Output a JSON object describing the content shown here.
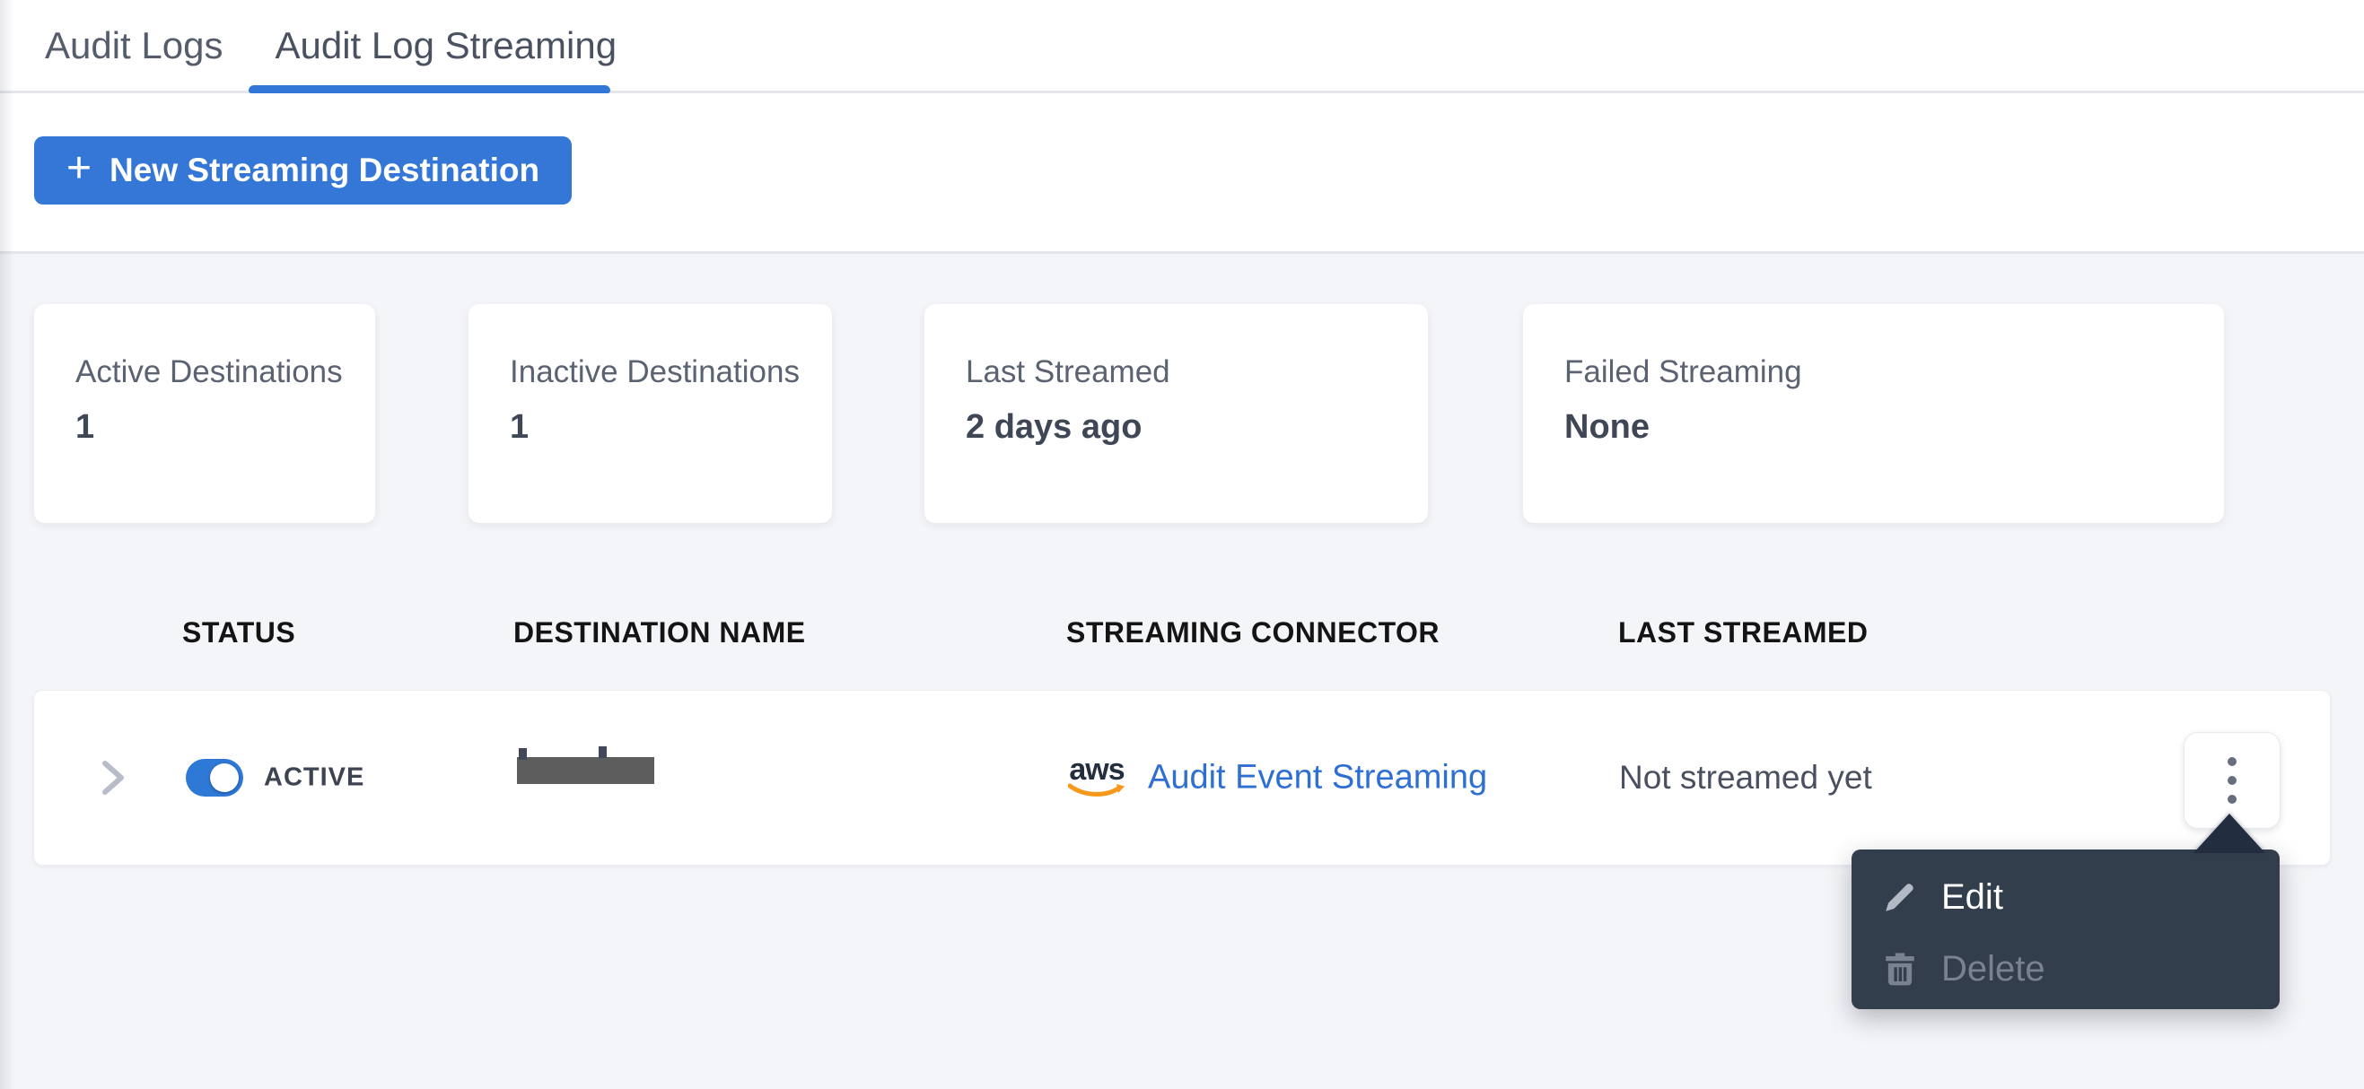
{
  "tabs": {
    "items": [
      {
        "label": "Audit Logs",
        "active": false
      },
      {
        "label": "Audit Log Streaming",
        "active": true
      }
    ]
  },
  "toolbar": {
    "plus_glyph": "+",
    "new_destination_label": "New Streaming Destination"
  },
  "stats": [
    {
      "label": "Active Destinations",
      "value": "1"
    },
    {
      "label": "Inactive Destinations",
      "value": "1"
    },
    {
      "label": "Last Streamed",
      "value": "2 days ago"
    },
    {
      "label": "Failed Streaming",
      "value": "None"
    }
  ],
  "table": {
    "headers": [
      "STATUS",
      "DESTINATION NAME",
      "STREAMING CONNECTOR",
      "LAST STREAMED"
    ],
    "row": {
      "status_label": "ACTIVE",
      "toggle_on": true,
      "destination_name_redacted": true,
      "connector_logo": "aws",
      "connector_label": "Audit Event Streaming",
      "last_streamed": "Not streamed yet"
    }
  },
  "menu": {
    "items": [
      {
        "label": "Edit",
        "icon": "pencil-icon",
        "disabled": false
      },
      {
        "label": "Delete",
        "icon": "trash-icon",
        "disabled": true
      }
    ]
  },
  "colors": {
    "accent_blue": "#3477d6",
    "link_blue": "#2e6fd4",
    "menu_bg": "#333e4c",
    "menu_arrow": "#232d40",
    "aws_orange": "#f7981d",
    "aws_navy": "#232f3e",
    "section_bg": "#f4f5f8"
  }
}
